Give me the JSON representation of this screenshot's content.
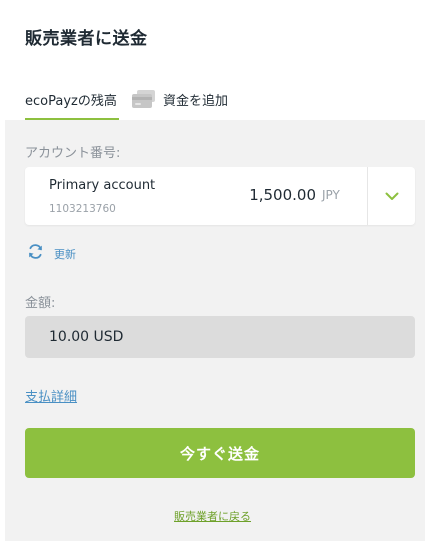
{
  "page": {
    "title": "販売業者に送金"
  },
  "tabs": [
    {
      "label": "ecoPayzの残高",
      "active": true
    },
    {
      "label": "資金を追加",
      "icon": "wallet-icon",
      "active": false
    }
  ],
  "account": {
    "label": "アカウント番号:",
    "name": "Primary account",
    "number": "1103213760",
    "balance": "1,500.00",
    "currency": "JPY",
    "dropdown_icon": "chevron-down-icon"
  },
  "refresh": {
    "label": "更新",
    "icon": "refresh-icon"
  },
  "amount": {
    "label": "金額:",
    "value": "10.00 USD"
  },
  "details_link": "支払詳細",
  "send_button": "今すぐ送金",
  "back_link": "販売業者に戻る",
  "colors": {
    "accent": "#8dc03f",
    "link": "#4a90c4",
    "panel": "#f2f2f2",
    "field": "#dcdcdc"
  }
}
